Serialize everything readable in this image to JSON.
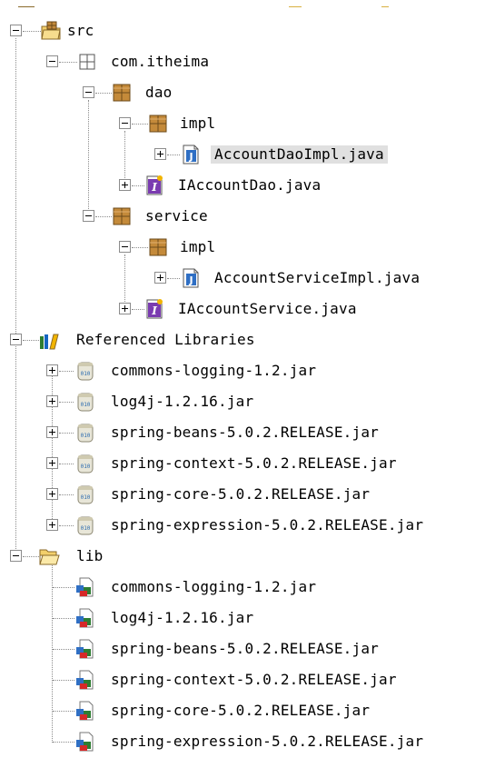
{
  "tree": {
    "src": "src",
    "package": "com.itheima",
    "dao": "dao",
    "dao_impl": "impl",
    "account_dao_impl": "AccountDaoImpl.java",
    "iaccount_dao": "IAccountDao.java",
    "service": "service",
    "service_impl": "impl",
    "account_service_impl": "AccountServiceImpl.java",
    "iaccount_service": "IAccountService.java",
    "referenced_libraries": "Referenced Libraries",
    "ref_jars": [
      "commons-logging-1.2.jar",
      "log4j-1.2.16.jar",
      "spring-beans-5.0.2.RELEASE.jar",
      "spring-context-5.0.2.RELEASE.jar",
      "spring-core-5.0.2.RELEASE.jar",
      "spring-expression-5.0.2.RELEASE.jar"
    ],
    "lib": "lib",
    "lib_jars": [
      "commons-logging-1.2.jar",
      "log4j-1.2.16.jar",
      "spring-beans-5.0.2.RELEASE.jar",
      "spring-context-5.0.2.RELEASE.jar",
      "spring-core-5.0.2.RELEASE.jar",
      "spring-expression-5.0.2.RELEASE.jar"
    ]
  },
  "colors": {
    "selection": "#e0e0e0",
    "package_brown": "#c48a3a",
    "java_blue": "#1c5fb0",
    "interface_purple": "#7a3bb0",
    "folder_yellow": "#f2cf6b"
  }
}
